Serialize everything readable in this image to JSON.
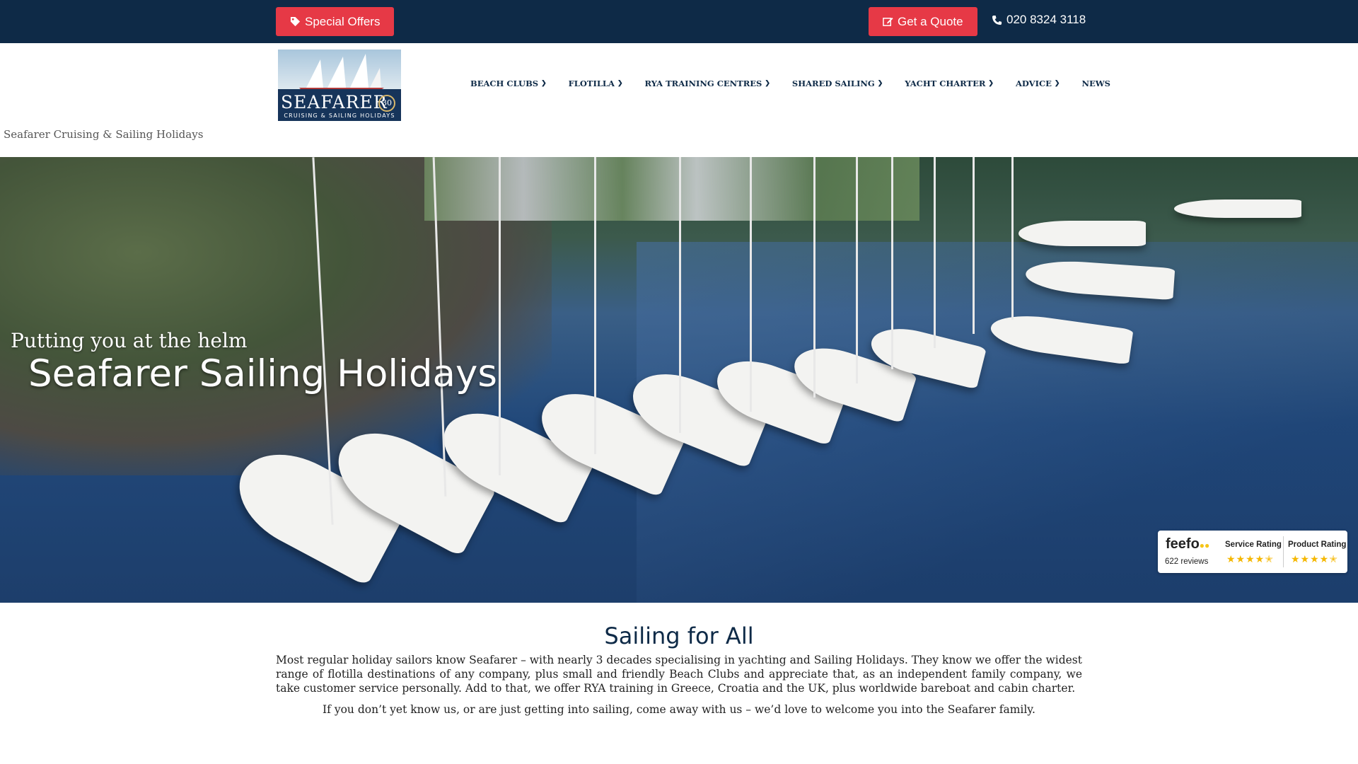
{
  "topbar": {
    "offers_label": "Special Offers",
    "quote_label": "Get a Quote",
    "phone": "020 8324 3118"
  },
  "logo": {
    "name": "SEAFARER",
    "badge": "30",
    "subtitle": "CRUISING & SAILING HOLIDAYS"
  },
  "nav": {
    "items": [
      {
        "label": "BEACH CLUBS",
        "has_menu": true
      },
      {
        "label": "FLOTILLA",
        "has_menu": true
      },
      {
        "label": "RYA TRAINING CENTRES",
        "has_menu": true
      },
      {
        "label": "SHARED SAILING",
        "has_menu": true
      },
      {
        "label": "YACHT CHARTER",
        "has_menu": true
      },
      {
        "label": "ADVICE",
        "has_menu": true
      },
      {
        "label": "NEWS",
        "has_menu": false
      }
    ]
  },
  "site_tagline": "Seafarer Cruising & Sailing Holidays",
  "hero": {
    "subtitle": "Putting you at the helm",
    "title": "Seafarer Sailing Holidays"
  },
  "feefo": {
    "logo": "feefo",
    "reviews": "622 reviews",
    "service_label": "Service Rating",
    "product_label": "Product Rating",
    "service_stars": 4.5,
    "product_stars": 4.5
  },
  "content": {
    "title": "Sailing for All",
    "paragraph1": "Most regular holiday sailors know Seafarer – with nearly 3 decades specialising in yachting and Sailing Holidays. They know we offer the widest range of flotilla destinations of any company, plus small and friendly Beach Clubs and appreciate that, as an independent family company, we take customer service personally. Add to that, we offer RYA training in Greece, Croatia and the UK, plus worldwide bareboat and cabin charter.",
    "paragraph2": "If you don’t yet know us, or are just getting into sailing, come away with us – we’d love to welcome you into the Seafarer family."
  },
  "colors": {
    "topbar_bg": "#0e2a47",
    "button_red": "#e63946",
    "nav_text": "#0e2a47",
    "star_gold": "#f5b700"
  },
  "icons": {
    "offers": "tag-icon",
    "quote": "edit-icon",
    "phone": "phone-icon",
    "dropdown": "chevron-down-icon"
  }
}
